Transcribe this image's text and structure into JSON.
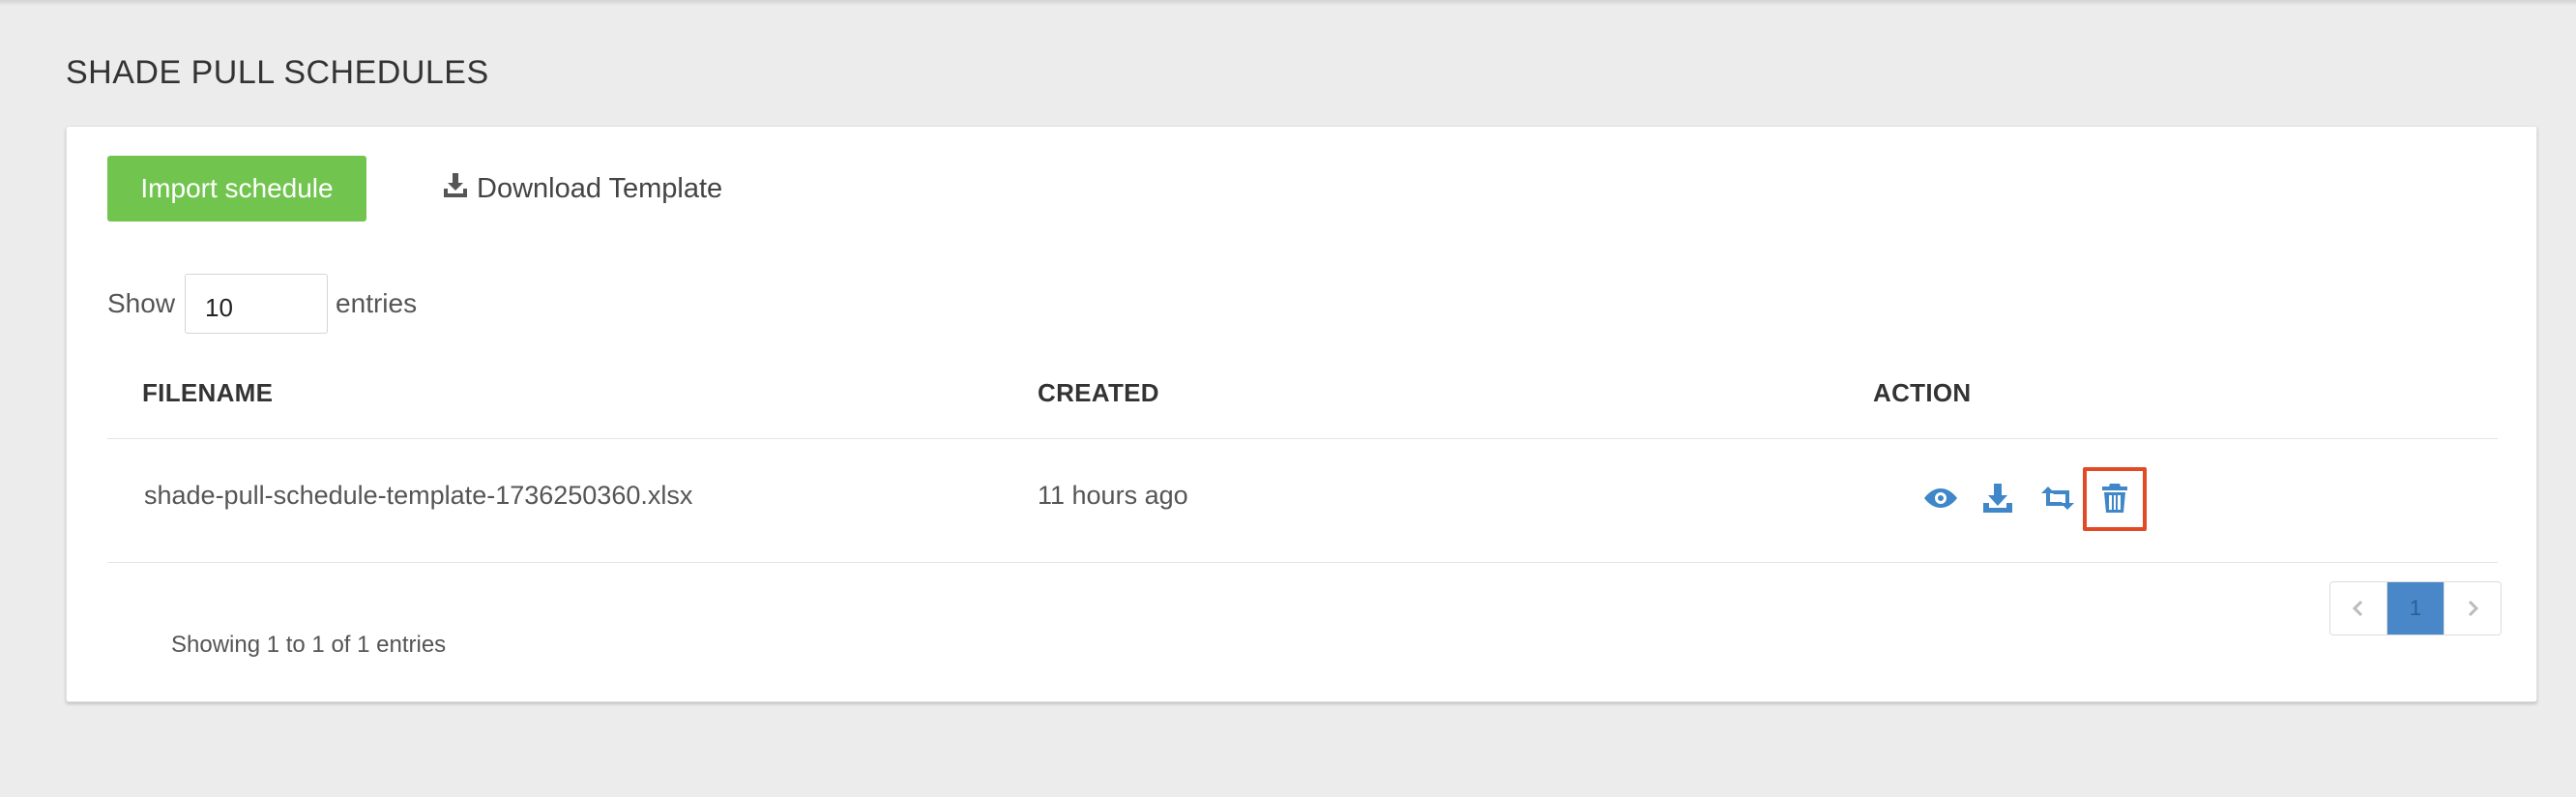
{
  "page": {
    "title": "SHADE PULL SCHEDULES"
  },
  "toolbar": {
    "import_label": "Import schedule",
    "download_label": "Download Template"
  },
  "length": {
    "show_label": "Show",
    "value": "10",
    "entries_label": "entries"
  },
  "table": {
    "columns": [
      "FILENAME",
      "CREATED",
      "ACTION"
    ],
    "rows": [
      {
        "filename": "shade-pull-schedule-template-1736250360.xlsx",
        "created": "11 hours ago",
        "actions": [
          "eye-icon",
          "download-icon",
          "retweet-icon",
          "trash-icon"
        ]
      }
    ]
  },
  "footer": {
    "info": "Showing 1 to 1 of 1 entries"
  },
  "pagination": {
    "current_page": "1"
  },
  "colors": {
    "import_button": "#71c54f",
    "action_icon": "#3f87c8",
    "highlight": "#e04a25",
    "active_page": "#4a87c9"
  }
}
